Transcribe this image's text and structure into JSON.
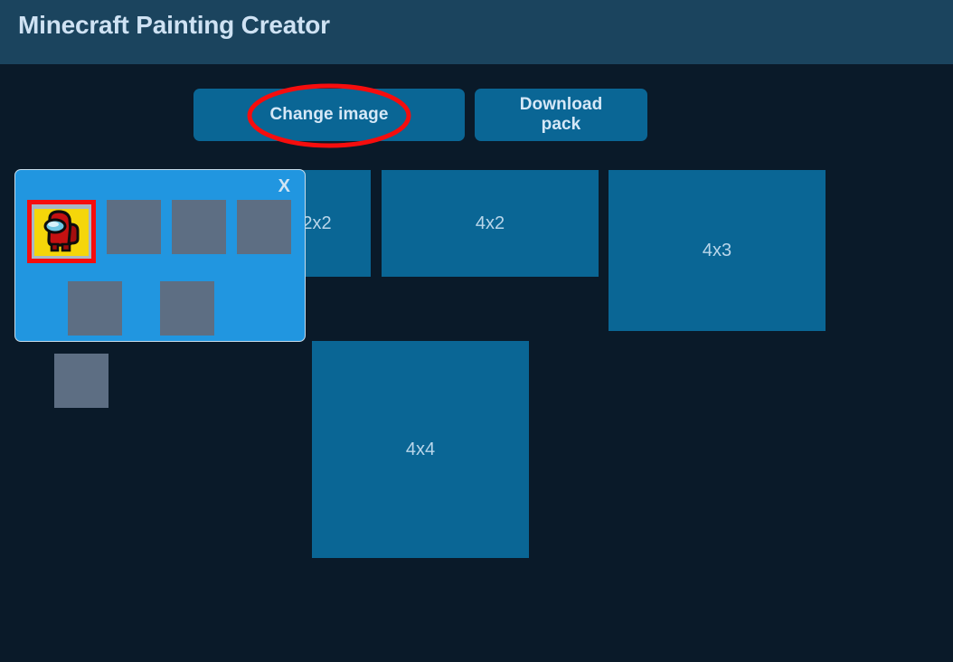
{
  "header": {
    "title": "Minecraft Painting Creator",
    "background": "#1b445e",
    "title_color": "#cfe2f3"
  },
  "page": {
    "background": "#0a1a29"
  },
  "toolbar": {
    "change_image_label": "Change image",
    "download_pack_label": "Download pack",
    "button_color": "#0a6695",
    "button_text_color": "#d6e8f7"
  },
  "annotation": {
    "shape": "ellipse",
    "color": "#f60d0d",
    "target": "Change image"
  },
  "size_cards": [
    {
      "id": "card-2x2",
      "label": "2x2"
    },
    {
      "id": "card-4x2",
      "label": "4x2"
    },
    {
      "id": "card-4x3",
      "label": "4x3"
    },
    {
      "id": "card-4x4",
      "label": "4x4"
    }
  ],
  "card_color": "#0a6695",
  "card_text_color": "#b9d6ea",
  "image_picker": {
    "visible": true,
    "background": "#2196e0",
    "border_color": "#c8dcea",
    "close_label": "X",
    "selection_color": "#f60d0d",
    "placeholder_color": "#5d6e83",
    "thumbnails": [
      {
        "index": 0,
        "name": "among-us-crewmate-red",
        "selected": true,
        "empty": false
      },
      {
        "index": 1,
        "name": "empty-slot",
        "selected": false,
        "empty": true
      },
      {
        "index": 2,
        "name": "empty-slot",
        "selected": false,
        "empty": true
      },
      {
        "index": 3,
        "name": "empty-slot",
        "selected": false,
        "empty": true
      },
      {
        "index": 4,
        "name": "empty-slot",
        "selected": false,
        "empty": true
      },
      {
        "index": 5,
        "name": "empty-slot",
        "selected": false,
        "empty": true
      },
      {
        "index": 6,
        "name": "empty-slot",
        "selected": false,
        "empty": true
      }
    ]
  }
}
